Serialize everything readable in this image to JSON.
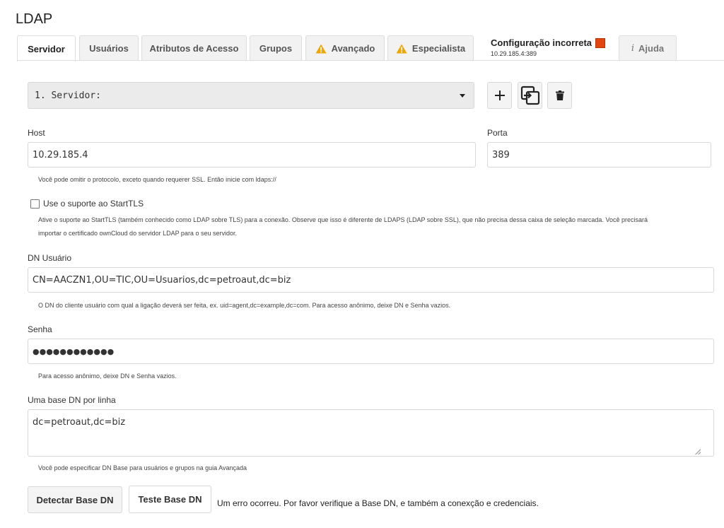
{
  "app": {
    "title": "LDAP"
  },
  "tabs": [
    {
      "label": "Servidor",
      "active": true
    },
    {
      "label": "Usuários"
    },
    {
      "label": "Atributos de Acesso"
    },
    {
      "label": "Grupos"
    },
    {
      "label": "Avançado",
      "icon": "warning-icon"
    },
    {
      "label": "Especialista",
      "icon": "warning-icon"
    }
  ],
  "status": {
    "title": "Configuração incorreta",
    "subtitle": "10.29.185.4:389",
    "color": "#e2450e"
  },
  "help_tab": {
    "label": "Ajuda",
    "icon": "info-icon"
  },
  "server_select": {
    "value": "1. Servidor:"
  },
  "server_actions": {
    "add": "+",
    "icons": [
      "plus-icon",
      "copy-icon",
      "trash-icon"
    ]
  },
  "host": {
    "label": "Host",
    "value": "10.29.185.4",
    "hint": "Você pode omitir o protocolo, exceto quando requerer SSL. Então inicie com ldaps://"
  },
  "port": {
    "label": "Porta",
    "value": "389"
  },
  "starttls": {
    "label": "Use o suporte ao StartTLS",
    "checked": false,
    "hint_line1": "Ative o suporte ao StartTLS (também conhecido como LDAP sobre TLS) para a conexão. Observe que isso é diferente de LDAPS (LDAP sobre SSL), que não precisa dessa caixa de seleção marcada. Você precisará",
    "hint_line2": "importar o certificado ownCloud do servidor LDAP para o seu servidor."
  },
  "user_dn": {
    "label": "DN Usuário",
    "value": "CN=AACZN1,OU=TIC,OU=Usuarios,dc=petroaut,dc=biz",
    "hint": "O DN do cliente usuário com qual a ligação deverá ser feita, ex. uid=agent,dc=example,dc=com. Para acesso anônimo, deixe DN e Senha vazios."
  },
  "password": {
    "label": "Senha",
    "value": "●●●●●●●●●●●●",
    "hint": "Para acesso anônimo, deixe DN e Senha vazios."
  },
  "base_dn": {
    "label": "Uma base DN por linha",
    "value": "dc=petroaut,dc=biz",
    "hint": "Você pode especificar DN Base para usuários e grupos na guia Avançada"
  },
  "buttons": {
    "detect": "Detectar Base DN",
    "test": "Teste Base DN"
  },
  "error_message": "Um erro ocorreu. Por favor verifique a Base DN, e também a conexção e credenciais."
}
